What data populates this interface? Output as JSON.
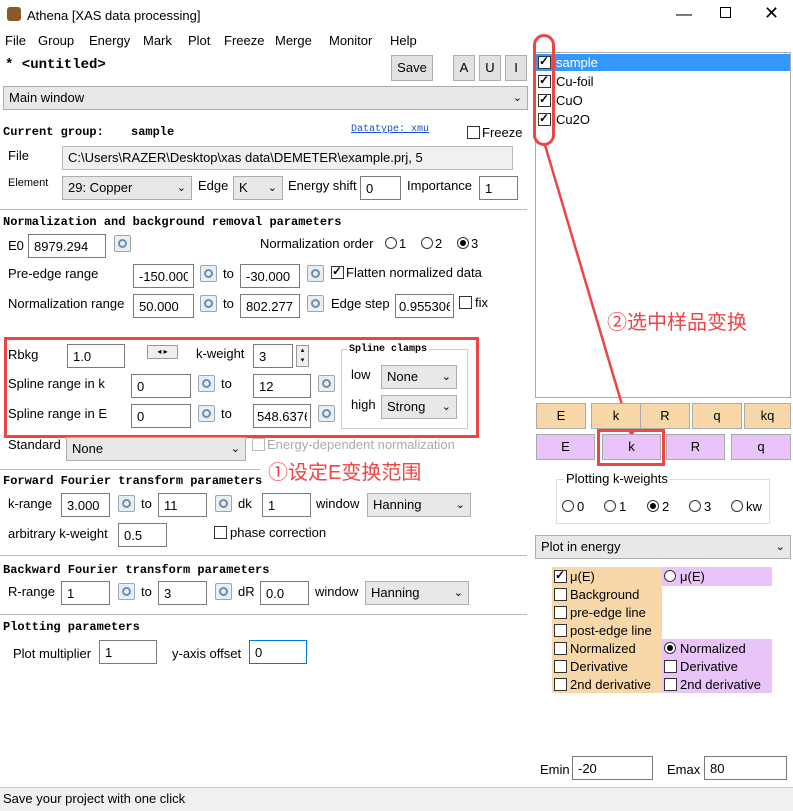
{
  "app": {
    "title": "Athena [XAS data processing]"
  },
  "menu": [
    "File",
    "Group",
    "Energy",
    "Mark",
    "Plot",
    "Freeze",
    "Merge",
    "Monitor",
    "Help"
  ],
  "project": {
    "name": "* <untitled>",
    "save": "Save",
    "a": "A",
    "u": "U",
    "i": "I"
  },
  "view_select": "Main window",
  "current_group": {
    "label": "Current group:",
    "name": "sample",
    "datatype": "Datatype: xmu",
    "freeze": "Freeze"
  },
  "file": {
    "label": "File",
    "value": "C:\\Users\\RAZER\\Desktop\\xas data\\DEMETER\\example.prj, 5"
  },
  "element": {
    "label": "Element",
    "value": "29: Copper",
    "edge_label": "Edge",
    "edge": "K",
    "shift_label": "Energy shift",
    "shift": "0",
    "importance_label": "Importance",
    "importance": "1"
  },
  "norm": {
    "header": "Normalization and background removal parameters",
    "e0_label": "E0",
    "e0": "8979.294",
    "order_label": "Normalization order",
    "o1": "1",
    "o2": "2",
    "o3": "3",
    "pre_label": "Pre-edge range",
    "pre1": "-150.000",
    "pre2": "-30.000",
    "to": "to",
    "flatten": "Flatten normalized data",
    "nr_label": "Normalization range",
    "nr1": "50.000",
    "nr2": "802.277",
    "edgestep_label": "Edge step",
    "edgestep": "0.955306",
    "fix": "fix",
    "rbkg_label": "Rbkg",
    "rbkg": "1.0",
    "kw_label": "k-weight",
    "kw": "3",
    "clamps": "Spline clamps",
    "low": "low",
    "low_val": "None",
    "high": "high",
    "high_val": "Strong",
    "srk_label": "Spline range in k",
    "srk1": "0",
    "srk2": "12",
    "sre_label": "Spline range in E",
    "sre1": "0",
    "sre2": "548.6376",
    "std_label": "Standard",
    "std": "None",
    "edn": "Energy-dependent normalization"
  },
  "fft": {
    "header": "Forward Fourier transform parameters",
    "krange": "k-range",
    "k1": "3.000",
    "k2": "11",
    "dk_label": "dk",
    "dk": "1",
    "window_label": "window",
    "window": "Hanning",
    "arbkw_label": "arbitrary k-weight",
    "arbkw": "0.5",
    "phase": "phase correction"
  },
  "bft": {
    "header": "Backward Fourier transform parameters",
    "rrange": "R-range",
    "r1": "1",
    "r2": "3",
    "dr_label": "dR",
    "dr": "0.0",
    "window_label": "window",
    "window": "Hanning"
  },
  "plotp": {
    "header": "Plotting parameters",
    "mult_label": "Plot multiplier",
    "mult": "1",
    "yoff_label": "y-axis offset",
    "yoff": "0"
  },
  "groups": [
    "sample",
    "Cu-foil",
    "CuO",
    "Cu2O"
  ],
  "annotations": {
    "a1": "②选中样品变换",
    "a2": "①设定E变换范围"
  },
  "plotbtns1": [
    "E",
    "k",
    "R",
    "q",
    "kq"
  ],
  "plotbtns2": [
    "E",
    "k",
    "R",
    "q"
  ],
  "kweights": {
    "title": "Plotting k-weights",
    "opts": [
      "0",
      "1",
      "2",
      "3",
      "kw"
    ]
  },
  "plot_in": "Plot in energy",
  "energy_opts": {
    "left": [
      "μ(E)",
      "Background",
      "pre-edge line",
      "post-edge line",
      "Normalized",
      "Derivative",
      "2nd derivative"
    ],
    "right": [
      "μ(E)",
      "Normalized",
      "Derivative",
      "2nd derivative"
    ]
  },
  "emin_label": "Emin",
  "emin": "-20",
  "emax_label": "Emax",
  "emax": "80",
  "status": "Save your project with one click",
  "colors": {
    "orange": "#f8d8a8",
    "purple": "#e8c4f8",
    "annot": "#ee4444",
    "select": "#3399ff"
  }
}
